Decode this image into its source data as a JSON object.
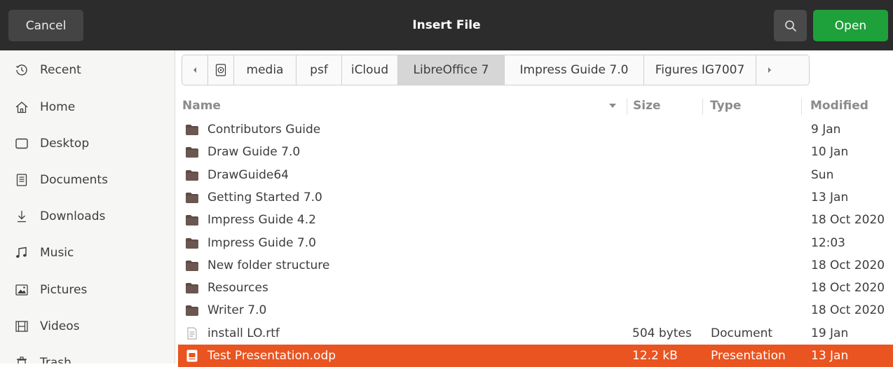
{
  "header": {
    "cancel_label": "Cancel",
    "title": "Insert File",
    "open_label": "Open",
    "colors": {
      "bar": "#2c2c2c",
      "open": "#1ea03b"
    }
  },
  "sidebar": {
    "items": [
      {
        "label": "Recent",
        "icon": "clock-icon"
      },
      {
        "label": "Home",
        "icon": "home-icon"
      },
      {
        "label": "Desktop",
        "icon": "desktop-icon"
      },
      {
        "label": "Documents",
        "icon": "documents-icon"
      },
      {
        "label": "Downloads",
        "icon": "download-icon"
      },
      {
        "label": "Music",
        "icon": "music-icon"
      },
      {
        "label": "Pictures",
        "icon": "pictures-icon"
      },
      {
        "label": "Videos",
        "icon": "videos-icon"
      },
      {
        "label": "Trash",
        "icon": "trash-icon"
      }
    ]
  },
  "pathbar": {
    "crumbs": [
      "media",
      "psf",
      "iCloud",
      "LibreOffice 7",
      "Impress Guide 7.0",
      "Figures IG7007"
    ],
    "active": "LibreOffice 7"
  },
  "columns": {
    "name": "Name",
    "size": "Size",
    "type": "Type",
    "modified": "Modified"
  },
  "files": [
    {
      "name": "Contributors Guide",
      "size": "",
      "type": "",
      "modified": "9 Jan",
      "kind": "folder"
    },
    {
      "name": "Draw Guide 7.0",
      "size": "",
      "type": "",
      "modified": "10 Jan",
      "kind": "folder"
    },
    {
      "name": "DrawGuide64",
      "size": "",
      "type": "",
      "modified": "Sun",
      "kind": "folder"
    },
    {
      "name": "Getting Started 7.0",
      "size": "",
      "type": "",
      "modified": "13 Jan",
      "kind": "folder"
    },
    {
      "name": "Impress Guide 4.2",
      "size": "",
      "type": "",
      "modified": "18 Oct 2020",
      "kind": "folder"
    },
    {
      "name": "Impress Guide 7.0",
      "size": "",
      "type": "",
      "modified": "12:03",
      "kind": "folder"
    },
    {
      "name": "New folder structure",
      "size": "",
      "type": "",
      "modified": "18 Oct 2020",
      "kind": "folder"
    },
    {
      "name": "Resources",
      "size": "",
      "type": "",
      "modified": "18 Oct 2020",
      "kind": "folder"
    },
    {
      "name": "Writer 7.0",
      "size": "",
      "type": "",
      "modified": "18 Oct 2020",
      "kind": "folder"
    },
    {
      "name": "install LO.rtf",
      "size": "504 bytes",
      "type": "Document",
      "modified": "19 Jan",
      "kind": "document"
    },
    {
      "name": "Test Presentation.odp",
      "size": "12.2 kB",
      "type": "Presentation",
      "modified": "13 Jan",
      "kind": "presentation",
      "selected": true
    }
  ],
  "colors": {
    "selection": "#e95420",
    "folder": "#5e4b44"
  }
}
